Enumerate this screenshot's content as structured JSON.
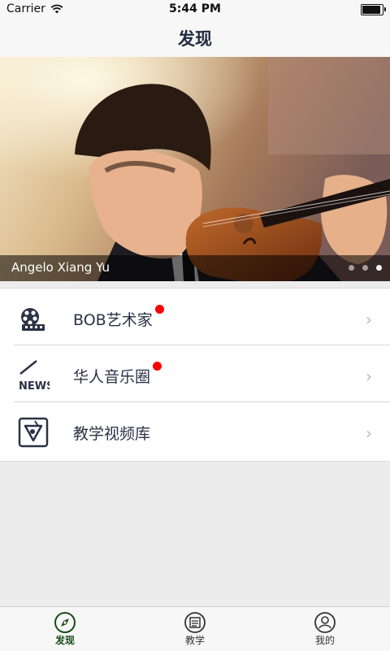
{
  "status_bar": {
    "carrier": "Carrier",
    "time": "5:44 PM"
  },
  "nav": {
    "title": "发现"
  },
  "banner": {
    "caption": "Angelo Xiang Yu",
    "page_count": 3,
    "active_page_index": 2
  },
  "menu": {
    "items": [
      {
        "label": "BOB艺术家",
        "icon": "film-reel-icon",
        "has_badge": true
      },
      {
        "label": "华人音乐圈",
        "icon": "news-icon",
        "has_badge": true
      },
      {
        "label": "教学视频库",
        "icon": "video-library-icon",
        "has_badge": false
      }
    ],
    "badge_color": "#ff0000"
  },
  "tabs": [
    {
      "label": "发现",
      "icon": "compass-icon",
      "active": true
    },
    {
      "label": "教学",
      "icon": "lesson-icon",
      "active": false
    },
    {
      "label": "我的",
      "icon": "profile-icon",
      "active": false
    }
  ],
  "colors": {
    "accent": "#1a4d1a",
    "text": "#2b3245"
  }
}
